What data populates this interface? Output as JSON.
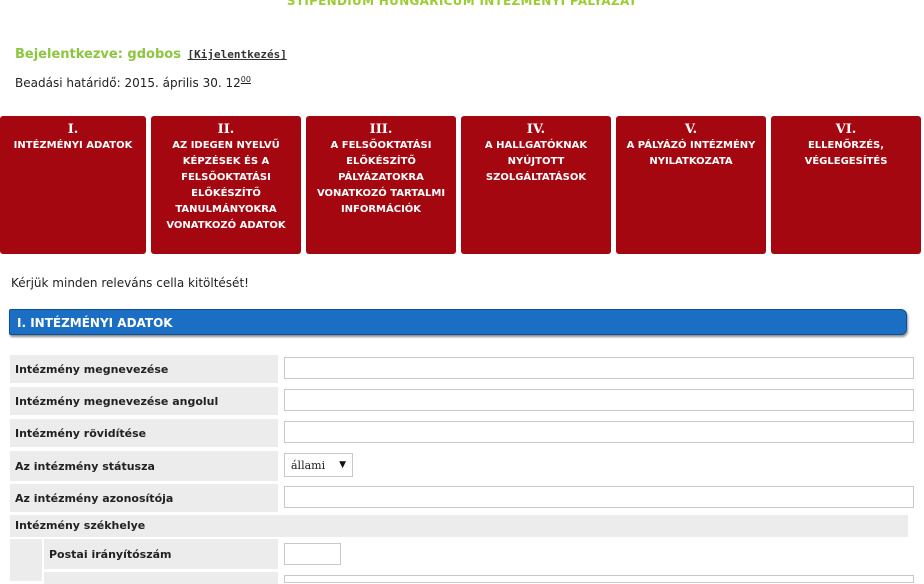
{
  "page_title": "STIPENDIUM HUNGARICUM INTÉZMÉNYI PÁLYÁZAT",
  "login": {
    "label": "Bejelentkezve: gdobos",
    "logout": "[Kijelentkezés]"
  },
  "deadline": {
    "text": "Beadási határidő: 2015. április 30. 12",
    "minutes": "00"
  },
  "tabs": [
    {
      "num": "I.",
      "label": "INTÉZMÉNYI ADATOK"
    },
    {
      "num": "II.",
      "label": "AZ IDEGEN NYELVŰ KÉPZÉSEK ÉS A FELSŐOKTATÁSI ELŐKÉSZÍTŐ TANULMÁNYOKRA VONATKOZÓ ADATOK"
    },
    {
      "num": "III.",
      "label": "A FELSŐOKTATÁSI ELŐKÉSZÍTŐ PÁLYÁZATOKRA VONATKOZÓ TARTALMI INFORMÁCIÓK"
    },
    {
      "num": "IV.",
      "label": "A HALLGATÓKNAK NYÚJTOTT SZOLGÁLTATÁSOK"
    },
    {
      "num": "V.",
      "label": "A PÁLYÁZÓ INTÉZMÉNY NYILATKOZATA"
    },
    {
      "num": "VI.",
      "label": "ELLENŐRZÉS, VÉGLEGESÍTÉS"
    }
  ],
  "notice": "Kérjük minden releváns cella kitöltését!",
  "section": {
    "title": "I. INTÉZMÉNYI ADATOK"
  },
  "fields": {
    "name": {
      "label": "Intézmény megnevezése",
      "value": ""
    },
    "name_en": {
      "label": "Intézmény megnevezése angolul",
      "value": ""
    },
    "abbr": {
      "label": "Intézmény rövidítése",
      "value": ""
    },
    "status": {
      "label": "Az intézmény státusza",
      "value": "állami"
    },
    "id": {
      "label": "Az intézmény azonosítója",
      "value": ""
    },
    "seat": {
      "label": "Intézmény székhelye"
    },
    "zip": {
      "label": "Postai irányítószám",
      "value": ""
    }
  },
  "colors": {
    "tab_bg": "#a50710",
    "section_bg": "#1a6fc4",
    "login_green": "#8cc63e"
  }
}
